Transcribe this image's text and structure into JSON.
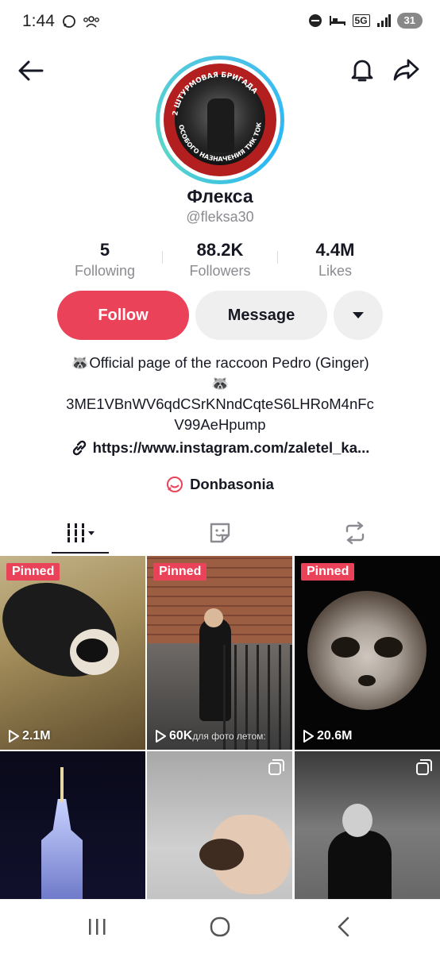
{
  "status_bar": {
    "time": "1:44",
    "network": "5G",
    "battery": "31"
  },
  "profile": {
    "display_name": "Флекса",
    "username": "@fleksa30",
    "avatar_text": "2 ШТУРМОВАЯ БРИГАДА · ОСОБОГО НАЗНАЧЕНИЯ ТИК ТОК"
  },
  "stats": [
    {
      "value": "5",
      "label": "Following"
    },
    {
      "value": "88.2K",
      "label": "Followers"
    },
    {
      "value": "4.4M",
      "label": "Likes"
    }
  ],
  "actions": {
    "follow_label": "Follow",
    "message_label": "Message"
  },
  "bio": {
    "line1": "🦝Official page of the raccoon Pedro (Ginger)",
    "line2": "🦝",
    "line3": "3ME1VBnWV6qdCSrKNndCqteS6LHRoM4nFc",
    "line4": "V99AeHpump"
  },
  "link": {
    "text": "https://www.instagram.com/zaletel_ka..."
  },
  "community": {
    "name": "Donbasonia"
  },
  "tabs": [
    {
      "name": "videos",
      "icon": "grid-icon"
    },
    {
      "name": "reposts-stickers",
      "icon": "sticker-icon"
    },
    {
      "name": "reposts",
      "icon": "repost-icon"
    }
  ],
  "videos": [
    {
      "pinned_label": "Pinned",
      "views": "2.1M"
    },
    {
      "pinned_label": "Pinned",
      "views": "60K",
      "caption": "для фото летом:"
    },
    {
      "pinned_label": "Pinned",
      "views": "20.6M"
    },
    {
      "views": ""
    },
    {
      "views": ""
    },
    {
      "views": ""
    }
  ],
  "colors": {
    "accent": "#ea4359",
    "secondary_button": "#efefef",
    "muted_text": "#8a8b91"
  }
}
